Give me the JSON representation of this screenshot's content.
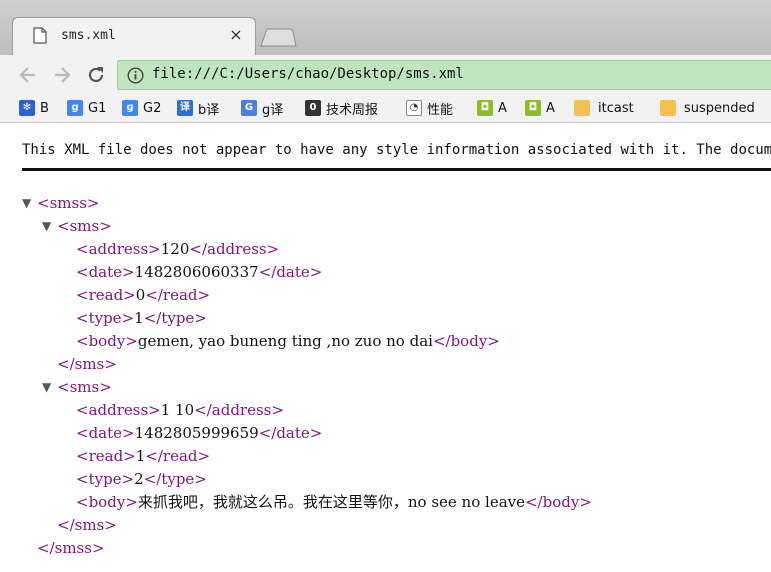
{
  "tab": {
    "title": "sms.xml",
    "close_glyph": "×"
  },
  "omnibox": {
    "url": "file:///C:/Users/chao/Desktop/sms.xml"
  },
  "bookmarks": [
    {
      "label": "B",
      "icon": "baidu-paw-icon"
    },
    {
      "label": "G1",
      "icon": "google-g-icon"
    },
    {
      "label": "G2",
      "icon": "google-g-icon"
    },
    {
      "label": "b译",
      "icon": "baidu-translate-icon"
    },
    {
      "label": "g译",
      "icon": "google-translate-icon"
    },
    {
      "label": "技术周报",
      "icon": "weekly-icon"
    },
    {
      "label": "性能",
      "icon": "performance-icon"
    },
    {
      "label": "A",
      "icon": "android-icon"
    },
    {
      "label": "A",
      "icon": "android-icon"
    },
    {
      "label": "itcast",
      "icon": "folder-icon"
    },
    {
      "label": "suspended",
      "icon": "folder-icon"
    }
  ],
  "colors": {
    "accent_green": "#bfe5bf",
    "xml_tag": "#881280",
    "text": "#111111"
  },
  "xml_viewer": {
    "notice": "This XML file does not appear to have any style information associated with it. The document tree is shown below.",
    "toggle_glyph": "▼",
    "root_tag": "smss",
    "messages": [
      {
        "tag": "sms",
        "fields": [
          {
            "name": "address",
            "value": "120"
          },
          {
            "name": "date",
            "value": "1482806060337"
          },
          {
            "name": "read",
            "value": "0"
          },
          {
            "name": "type",
            "value": "1"
          },
          {
            "name": "body",
            "value": "gemen, yao buneng ting ,no zuo no dai"
          }
        ]
      },
      {
        "tag": "sms",
        "fields": [
          {
            "name": "address",
            "value": "1 10"
          },
          {
            "name": "date",
            "value": "1482805999659"
          },
          {
            "name": "read",
            "value": "1"
          },
          {
            "name": "type",
            "value": "2"
          },
          {
            "name": "body",
            "value": "来抓我吧，我就这么吊。我在这里等你，no see no leave"
          }
        ]
      }
    ]
  }
}
